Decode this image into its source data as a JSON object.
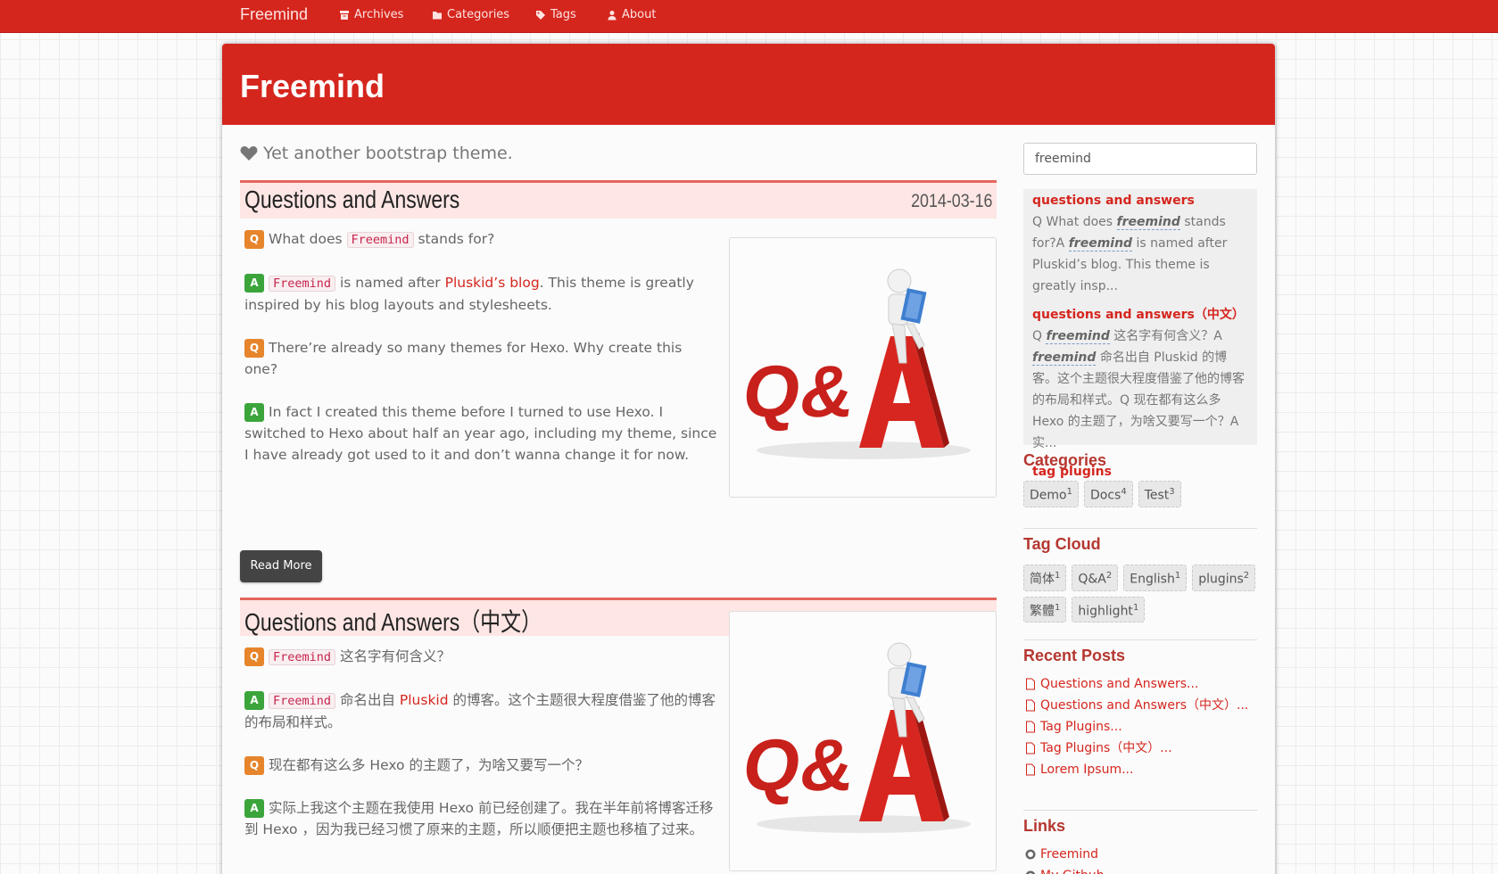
{
  "navbar": {
    "brand": "Freemind",
    "links": [
      {
        "label": "Archives",
        "icon": "archive-icon"
      },
      {
        "label": "Categories",
        "icon": "folder-icon"
      },
      {
        "label": "Tags",
        "icon": "tags-icon"
      },
      {
        "label": "About",
        "icon": "user-icon"
      }
    ]
  },
  "header": {
    "title": "Freemind"
  },
  "tagline": "Yet another bootstrap theme.",
  "posts": [
    {
      "title": "Questions and Answers",
      "date": "2014-03-16",
      "items": [
        {
          "badge": "Q",
          "pre": "What does ",
          "code": "Freemind",
          "post": " stands for?"
        },
        {
          "badge": "A",
          "code": "Freemind",
          "mid": " is named after ",
          "link": "Pluskid’s blog",
          "post": ". This theme is greatly inspired by his blog layouts and stylesheets."
        },
        {
          "badge": "Q",
          "text": "There’re already so many themes for Hexo. Why create this one?"
        },
        {
          "badge": "A",
          "text": "In fact I created this theme before I turned to use Hexo. I switched to Hexo about half an year ago, including my theme, since I have already got used to it and don’t wanna change it for now."
        }
      ],
      "read_more": "Read More"
    },
    {
      "title": "Questions and Answers（中文）",
      "date": "2014-03-16",
      "items": [
        {
          "badge": "Q",
          "code": "Freemind",
          "post": " 这名字有何含义？"
        },
        {
          "badge": "A",
          "code": "Freemind",
          "mid": " 命名出自 ",
          "link": "Pluskid",
          "post": " 的博客。这个主题很大程度借鉴了他的博客的布局和样式。"
        },
        {
          "badge": "Q",
          "text": "现在都有这么多 Hexo 的主题了，为啥又要写一个？"
        },
        {
          "badge": "A",
          "text": "实际上我这个主题在我使用 Hexo 前已经创建了。我在半年前将博客迁移到 Hexo ，因为我已经习惯了原来的主题，所以顺便把主题也移植了过来。"
        }
      ]
    }
  ],
  "search": {
    "value": "freemind",
    "results": [
      {
        "title": "questions and answers",
        "s1": "Q What does ",
        "h1": "freemind",
        "s2": " stands for?A ",
        "h2": "freemind",
        "s3": " is named after Pluskid’s blog. This theme is greatly insp..."
      },
      {
        "title": "questions and answers（中文）",
        "s1": "Q ",
        "h1": "freemind",
        "s2": " 这名字有何含义？A ",
        "h2": "freemind",
        "s3": " 命名出自 Pluskid 的博客。这个主题很大程度借鉴了他的博客的布局和样式。Q 现在都有这么多 Hexo 的主题了，为啥又要写一个？A 实..."
      },
      {
        "title": "tag plugins"
      }
    ]
  },
  "sidebar": {
    "categories_title": "Categories",
    "categories": [
      {
        "name": "Demo",
        "count": "1"
      },
      {
        "name": "Docs",
        "count": "4"
      },
      {
        "name": "Test",
        "count": "3"
      }
    ],
    "tags_title": "Tag Cloud",
    "tags": [
      {
        "name": "简体",
        "count": "1"
      },
      {
        "name": "Q&A",
        "count": "2"
      },
      {
        "name": "English",
        "count": "1"
      },
      {
        "name": "plugins",
        "count": "2"
      },
      {
        "name": "繁體",
        "count": "1"
      },
      {
        "name": "highlight",
        "count": "1"
      }
    ],
    "recent_title": "Recent Posts",
    "recent": [
      "Questions and Answers...",
      "Questions and Answers（中文）...",
      "Tag Plugins...",
      "Tag Plugins（中文）...",
      "Lorem Ipsum..."
    ],
    "links_title": "Links",
    "links": [
      "Freemind",
      "My Github"
    ]
  },
  "colors": {
    "primary": "#d5261e",
    "badge_q": "#e7852c",
    "badge_a": "#3ba53b"
  }
}
